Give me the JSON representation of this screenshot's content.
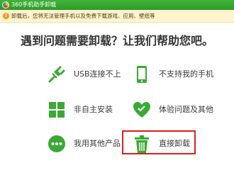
{
  "window": {
    "title": "360手机助手卸载"
  },
  "warning": {
    "text": "卸载后，您将无法管理手机以及免费下载游戏、应用、壁纸等"
  },
  "headline": "遇到问题需要卸载？让我们帮助您吧。",
  "options": [
    {
      "label": "USB连接不上",
      "icon": "usb-icon"
    },
    {
      "label": "不支持我的手机",
      "icon": "phone-icon"
    },
    {
      "label": "非自主安装",
      "icon": "grid-icon"
    },
    {
      "label": "体验问题及其他",
      "icon": "heart-icon"
    },
    {
      "label": "我用其他产品",
      "icon": "more-icon"
    },
    {
      "label": "直接卸载",
      "icon": "trash-icon"
    }
  ],
  "colors": {
    "accent": "#3aa935",
    "titlebar": "#2e9a29",
    "highlight": "#d8201b"
  }
}
